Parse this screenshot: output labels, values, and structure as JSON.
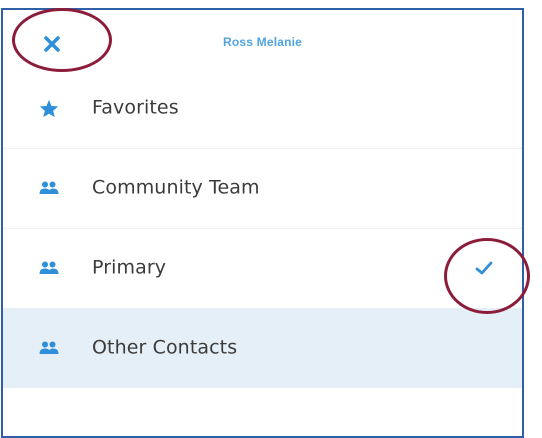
{
  "header": {
    "title": "Ross Melanie",
    "close_icon": "close-icon"
  },
  "groups": [
    {
      "label": "Favorites",
      "icon": "star-icon",
      "checked": false,
      "selected": false
    },
    {
      "label": "Community Team",
      "icon": "people-icon",
      "checked": false,
      "selected": false
    },
    {
      "label": "Primary",
      "icon": "people-icon",
      "checked": true,
      "selected": false
    },
    {
      "label": "Other Contacts",
      "icon": "people-icon",
      "checked": false,
      "selected": true
    }
  ],
  "colors": {
    "accent": "#2f8fd8",
    "title": "#4fa3df",
    "text": "#3b3b3b",
    "selected_row": "#e5eff7",
    "frame_border": "#2e5fa7",
    "annotation": "#8c1d3a"
  }
}
